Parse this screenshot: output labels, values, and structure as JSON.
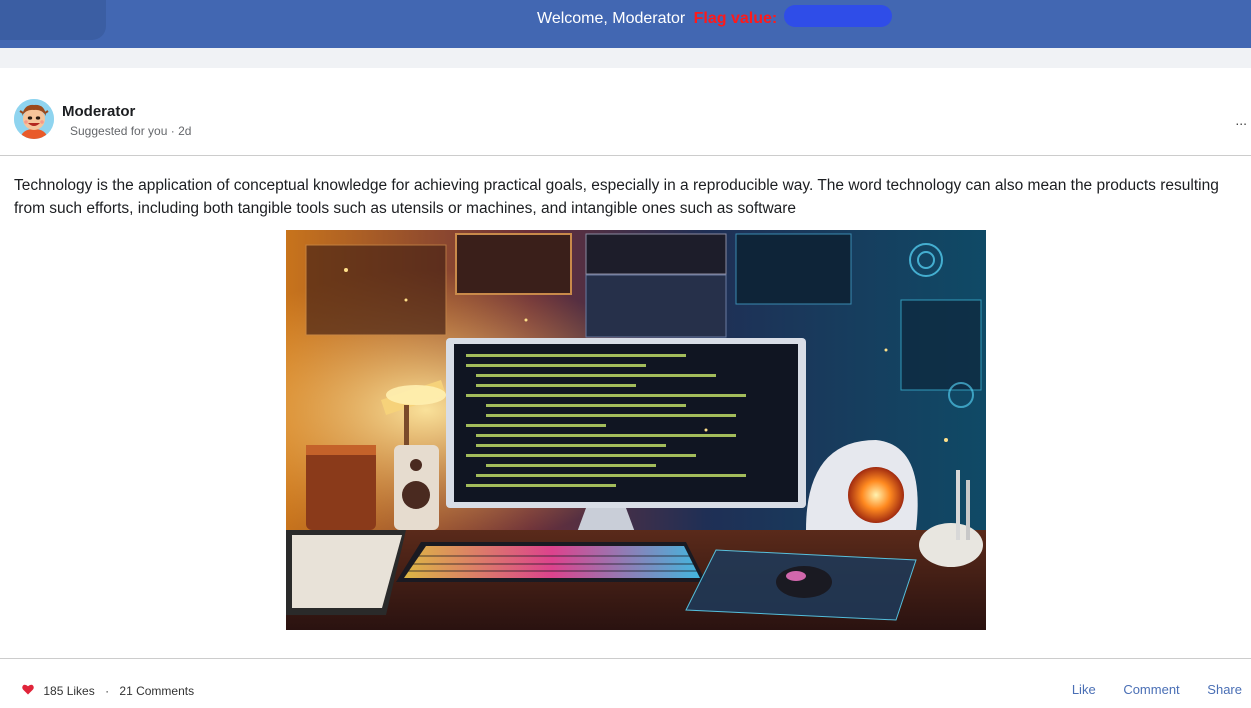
{
  "header": {
    "welcome_text": "Welcome, Moderator",
    "flag_label": "Flag value:"
  },
  "post": {
    "author": "Moderator",
    "meta": "Suggested for you · 2d",
    "more": "...",
    "text": "Technology is the application of conceptual knowledge for achieving practical goals, especially in a reproducible way. The word technology can also mean the products resulting from such efforts, including both tangible tools such as utensils or machines, and intangible ones such as software",
    "likes": "185 Likes",
    "separator": "·",
    "comments": "21 Comments",
    "actions": {
      "like": "Like",
      "comment": "Comment",
      "share": "Share"
    }
  },
  "colors": {
    "header_bg": "#4267b2",
    "flag_label": "#ff1a1a",
    "flag_redaction": "#2f4de8",
    "action_link": "#4a6fb5",
    "heart": "#e0243a"
  },
  "icons": [
    "avatar-cartoon",
    "heart-icon",
    "more-dots-icon"
  ]
}
